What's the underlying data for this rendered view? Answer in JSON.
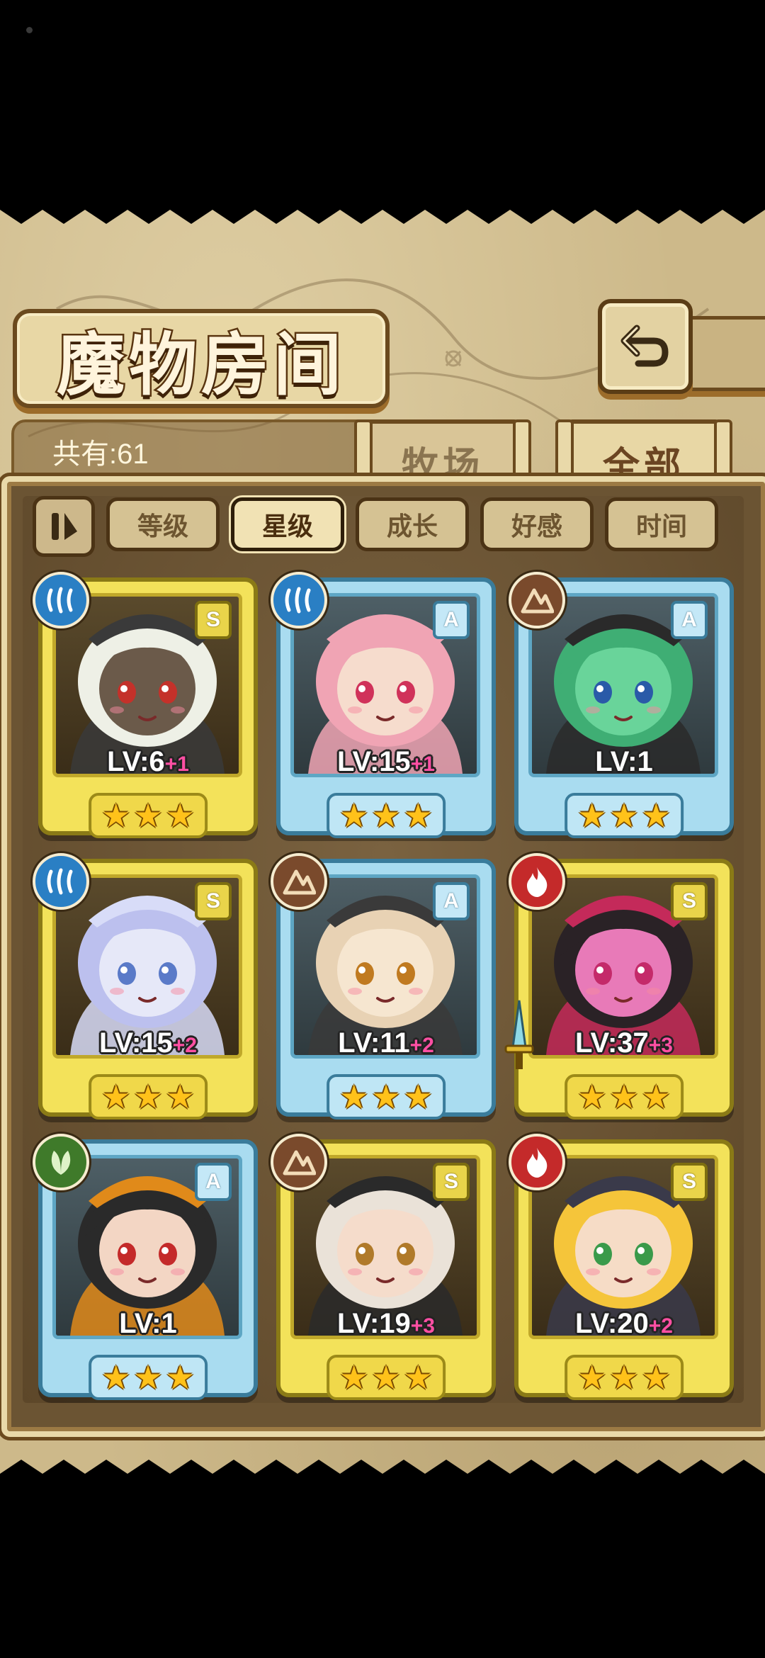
{
  "header": {
    "title": "魔物房间"
  },
  "summary": {
    "count_label": "共有:61"
  },
  "tabs": [
    {
      "label": "牧场",
      "active": false
    },
    {
      "label": "全部",
      "active": true
    }
  ],
  "filters": [
    {
      "label": "等级",
      "active": false
    },
    {
      "label": "星级",
      "active": true
    },
    {
      "label": "成长",
      "active": false
    },
    {
      "label": "好感",
      "active": false
    },
    {
      "label": "时间",
      "active": false
    }
  ],
  "monsters": [
    {
      "rank": "S",
      "element": "water",
      "level": "LV:6",
      "bonus": "+1",
      "stars": 3,
      "frame": "gold",
      "skin": "#6b5a4a",
      "hair": "#eef0e6",
      "eyes": "#c4312a",
      "hat": "#3a3a3a"
    },
    {
      "rank": "A",
      "element": "water",
      "level": "LV:15",
      "bonus": "+1",
      "stars": 3,
      "frame": "blue",
      "skin": "#f6dccd",
      "hair": "#f0a4b4",
      "eyes": "#d0325a",
      "hat": "#f0a4b4"
    },
    {
      "rank": "A",
      "element": "earth",
      "level": "LV:1",
      "bonus": "",
      "stars": 3,
      "frame": "blue",
      "skin": "#69d49a",
      "hair": "#3fae74",
      "eyes": "#2a5aa8",
      "hat": "#2a2a2a"
    },
    {
      "rank": "S",
      "element": "water",
      "level": "LV:15",
      "bonus": "+2",
      "stars": 3,
      "frame": "gold",
      "skin": "#e6e8f8",
      "hair": "#bcc0ee",
      "eyes": "#5a7ac8",
      "hat": "#d8dcf8"
    },
    {
      "rank": "A",
      "element": "earth",
      "level": "LV:11",
      "bonus": "+2",
      "stars": 3,
      "frame": "blue",
      "skin": "#f6e6d0",
      "hair": "#e8d2b4",
      "eyes": "#c07a20",
      "hat": "#3a3a3a"
    },
    {
      "rank": "S",
      "element": "fire",
      "level": "LV:37",
      "bonus": "+3",
      "stars": 3,
      "frame": "gold",
      "skin": "#e87ab8",
      "hair": "#2a2226",
      "eyes": "#c42a6a",
      "hat": "#c42a5a",
      "weapon": true
    },
    {
      "rank": "A",
      "element": "wood",
      "level": "LV:1",
      "bonus": "",
      "stars": 3,
      "frame": "blue",
      "skin": "#f3d6c4",
      "hair": "#2a2a2a",
      "eyes": "#c42a2a",
      "hat": "#e08a1a"
    },
    {
      "rank": "S",
      "element": "earth",
      "level": "LV:19",
      "bonus": "+3",
      "stars": 3,
      "frame": "gold",
      "skin": "#f5dccb",
      "hair": "#eae2d8",
      "eyes": "#b07a2a",
      "hat": "#2a2a2a"
    },
    {
      "rank": "S",
      "element": "fire",
      "level": "LV:20",
      "bonus": "+2",
      "stars": 3,
      "frame": "gold",
      "skin": "#f6dcc6",
      "hair": "#f5c53a",
      "eyes": "#3a9a4a",
      "hat": "#3a3a4a"
    }
  ]
}
